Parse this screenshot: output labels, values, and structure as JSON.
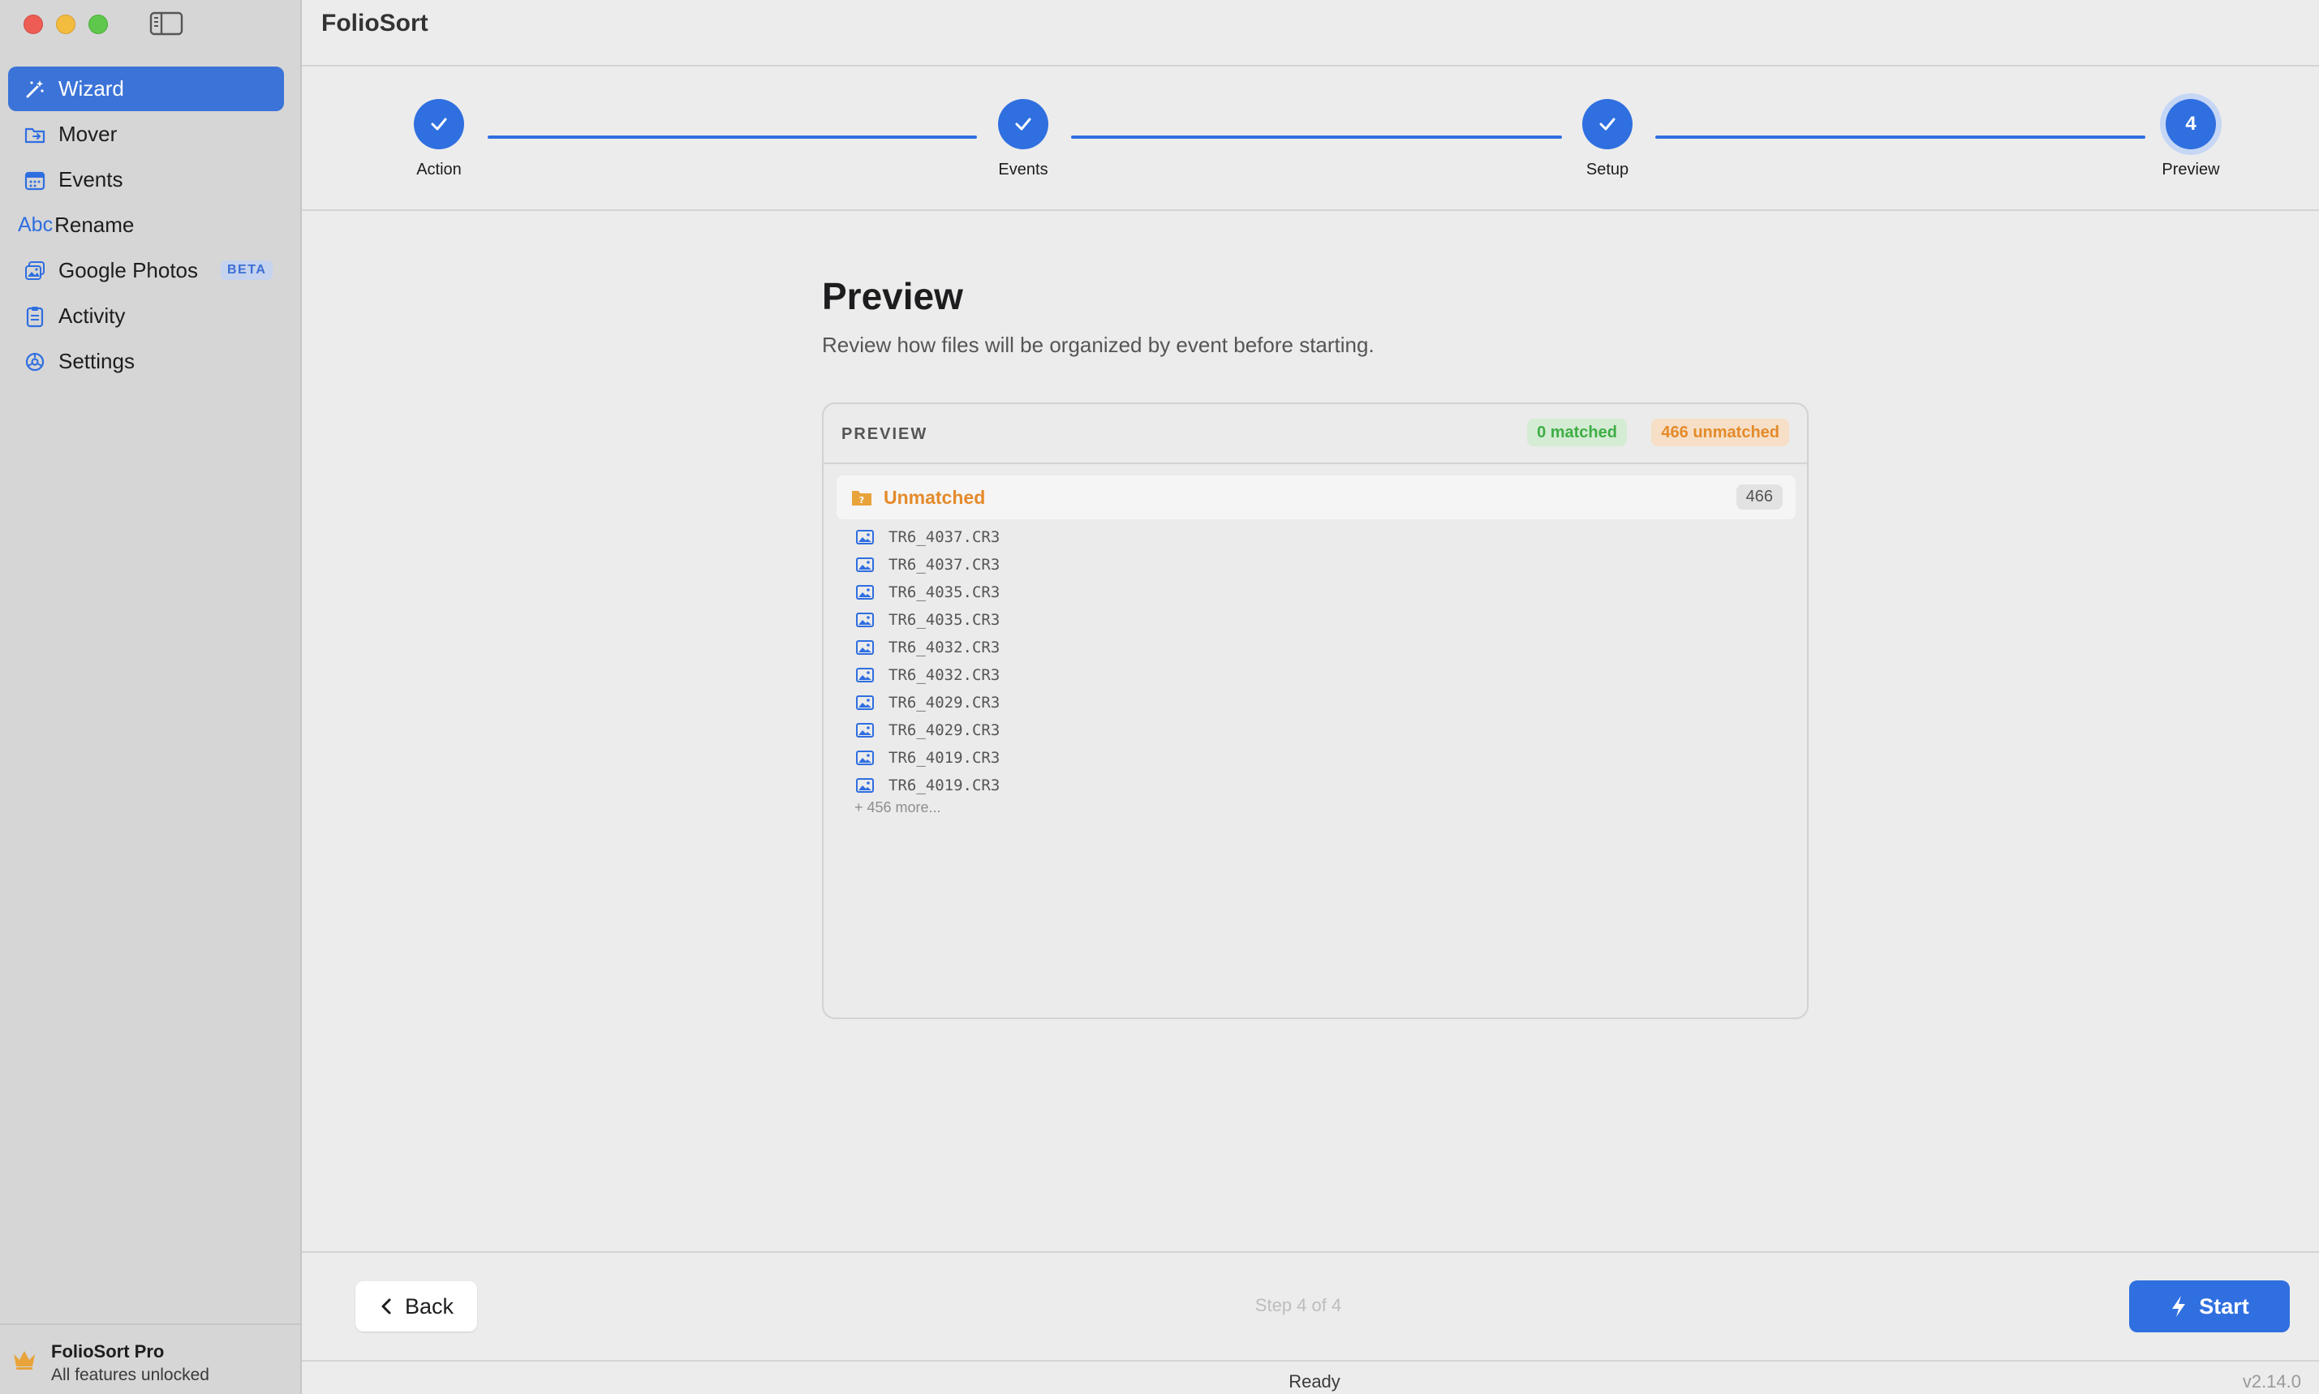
{
  "app": {
    "title": "FolioSort"
  },
  "sidebar": {
    "items": [
      {
        "label": "Wizard",
        "icon": "magic-wand-icon",
        "active": true
      },
      {
        "label": "Mover",
        "icon": "folder-move-icon"
      },
      {
        "label": "Events",
        "icon": "calendar-icon"
      },
      {
        "label": "Rename",
        "icon": "abc-text-icon",
        "icon_text": "Abc"
      },
      {
        "label": "Google Photos",
        "icon": "photos-icon",
        "badge": "BETA"
      },
      {
        "label": "Activity",
        "icon": "clipboard-icon"
      },
      {
        "label": "Settings",
        "icon": "gear-icon"
      }
    ],
    "footer": {
      "title": "FolioSort Pro",
      "subtitle": "All features unlocked",
      "icon": "crown-icon"
    }
  },
  "stepper": {
    "steps": [
      {
        "label": "Action",
        "state": "done"
      },
      {
        "label": "Events",
        "state": "done"
      },
      {
        "label": "Setup",
        "state": "done"
      },
      {
        "label": "Preview",
        "state": "current",
        "number": "4"
      }
    ]
  },
  "page": {
    "title": "Preview",
    "subtitle": "Review how files will be organized by event before starting."
  },
  "preview": {
    "header": "PREVIEW",
    "matched_badge": "0 matched",
    "unmatched_badge": "466 unmatched",
    "group": {
      "label": "Unmatched",
      "count": "466"
    },
    "files": [
      "TR6_4037.CR3",
      "TR6_4037.CR3",
      "TR6_4035.CR3",
      "TR6_4035.CR3",
      "TR6_4032.CR3",
      "TR6_4032.CR3",
      "TR6_4029.CR3",
      "TR6_4029.CR3",
      "TR6_4019.CR3",
      "TR6_4019.CR3"
    ],
    "more": "+ 456 more..."
  },
  "footer": {
    "back_label": "Back",
    "step_indicator": "Step 4 of 4",
    "start_label": "Start"
  },
  "status": {
    "text": "Ready",
    "version": "v2.14.0"
  },
  "colors": {
    "accent": "#2f6fe0",
    "matched": "#3fae46",
    "unmatched": "#e48a2a"
  }
}
